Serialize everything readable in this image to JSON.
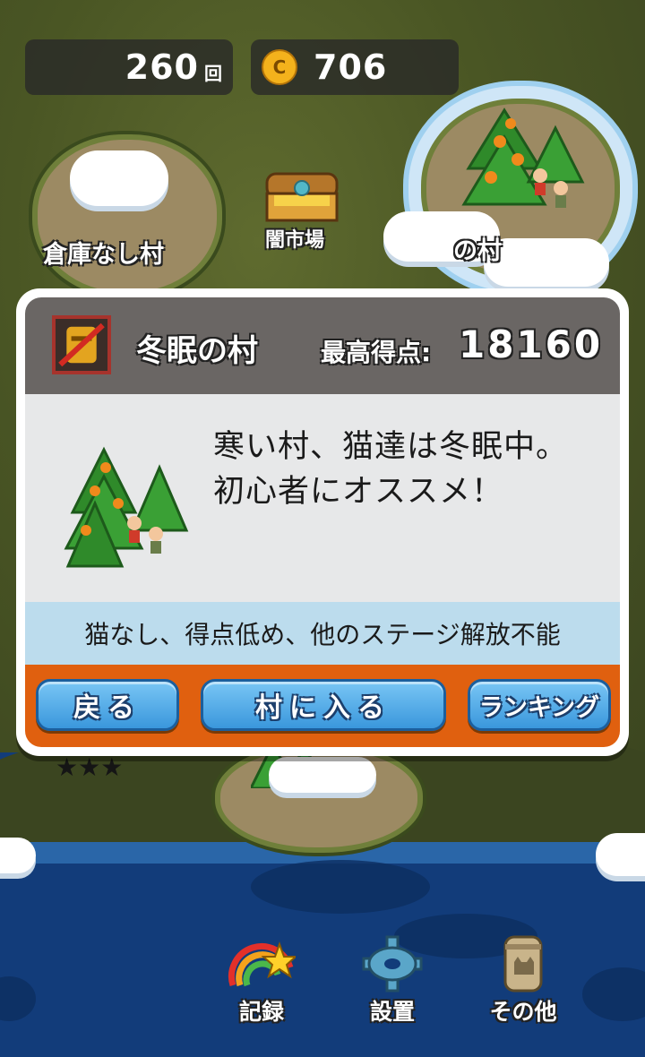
{
  "hud": {
    "plays_value": "260",
    "plays_unit": "回",
    "coin_symbol": "C",
    "coins_value": "706"
  },
  "map": {
    "home_village_label": "倉庫なし村",
    "black_market_label": "闇市場",
    "selected_village_label": "の村",
    "stars": "★★★"
  },
  "dialog": {
    "title": "冬眠の村",
    "best_score_label": "最高得点:",
    "best_score_value": "18160",
    "description": "寒い村、猫達は冬眠中。初心者にオススメ！",
    "note": "猫なし、得点低め、他のステージ解放不能",
    "back_label": "戻る",
    "enter_label": "村に入る",
    "ranking_label": "ランキング"
  },
  "nav": {
    "record_label": "記録",
    "settings_label": "設置",
    "other_label": "その他"
  },
  "colors": {
    "dialog_header": "#6a6664",
    "dialog_body": "#e7e8e9",
    "note_bg": "#bcdced",
    "footer_orange": "#e0600f",
    "button_blue": "#3a97dc",
    "sea": "#123c7a",
    "land": "#4a5624"
  }
}
